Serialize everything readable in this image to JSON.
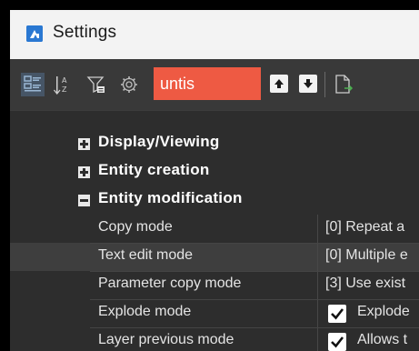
{
  "window": {
    "title": "Settings",
    "app_icon": "settings-app-icon",
    "accent": "#2a78d2"
  },
  "toolbar": {
    "search_value": "untis",
    "search_color": "#ee5a43",
    "buttons": [
      {
        "name": "categorized-view-icon",
        "active": true
      },
      {
        "name": "sort-az-icon",
        "active": false
      },
      {
        "name": "filter-icon",
        "active": false
      },
      {
        "name": "gear-icon",
        "active": false
      },
      {
        "name": "find-previous-icon",
        "active": false
      },
      {
        "name": "find-next-icon",
        "active": false
      },
      {
        "name": "export-icon",
        "active": false
      }
    ]
  },
  "tree": {
    "categories": [
      {
        "label": "Display/Viewing",
        "expanded": false
      },
      {
        "label": "Entity creation",
        "expanded": false
      },
      {
        "label": "Entity modification",
        "expanded": true
      }
    ],
    "properties": [
      {
        "name": "Copy mode",
        "value": "[0] Repeat a",
        "type": "text"
      },
      {
        "name": "Text edit mode",
        "value": "[0] Multiple e",
        "type": "text",
        "selected": true
      },
      {
        "name": "Parameter copy mode",
        "value": "[3] Use exist",
        "type": "text"
      },
      {
        "name": "Explode mode",
        "value": "Explode",
        "type": "checkbox",
        "checked": true
      },
      {
        "name": "Layer previous mode",
        "value": "Allows t",
        "type": "checkbox",
        "checked": true
      }
    ]
  }
}
